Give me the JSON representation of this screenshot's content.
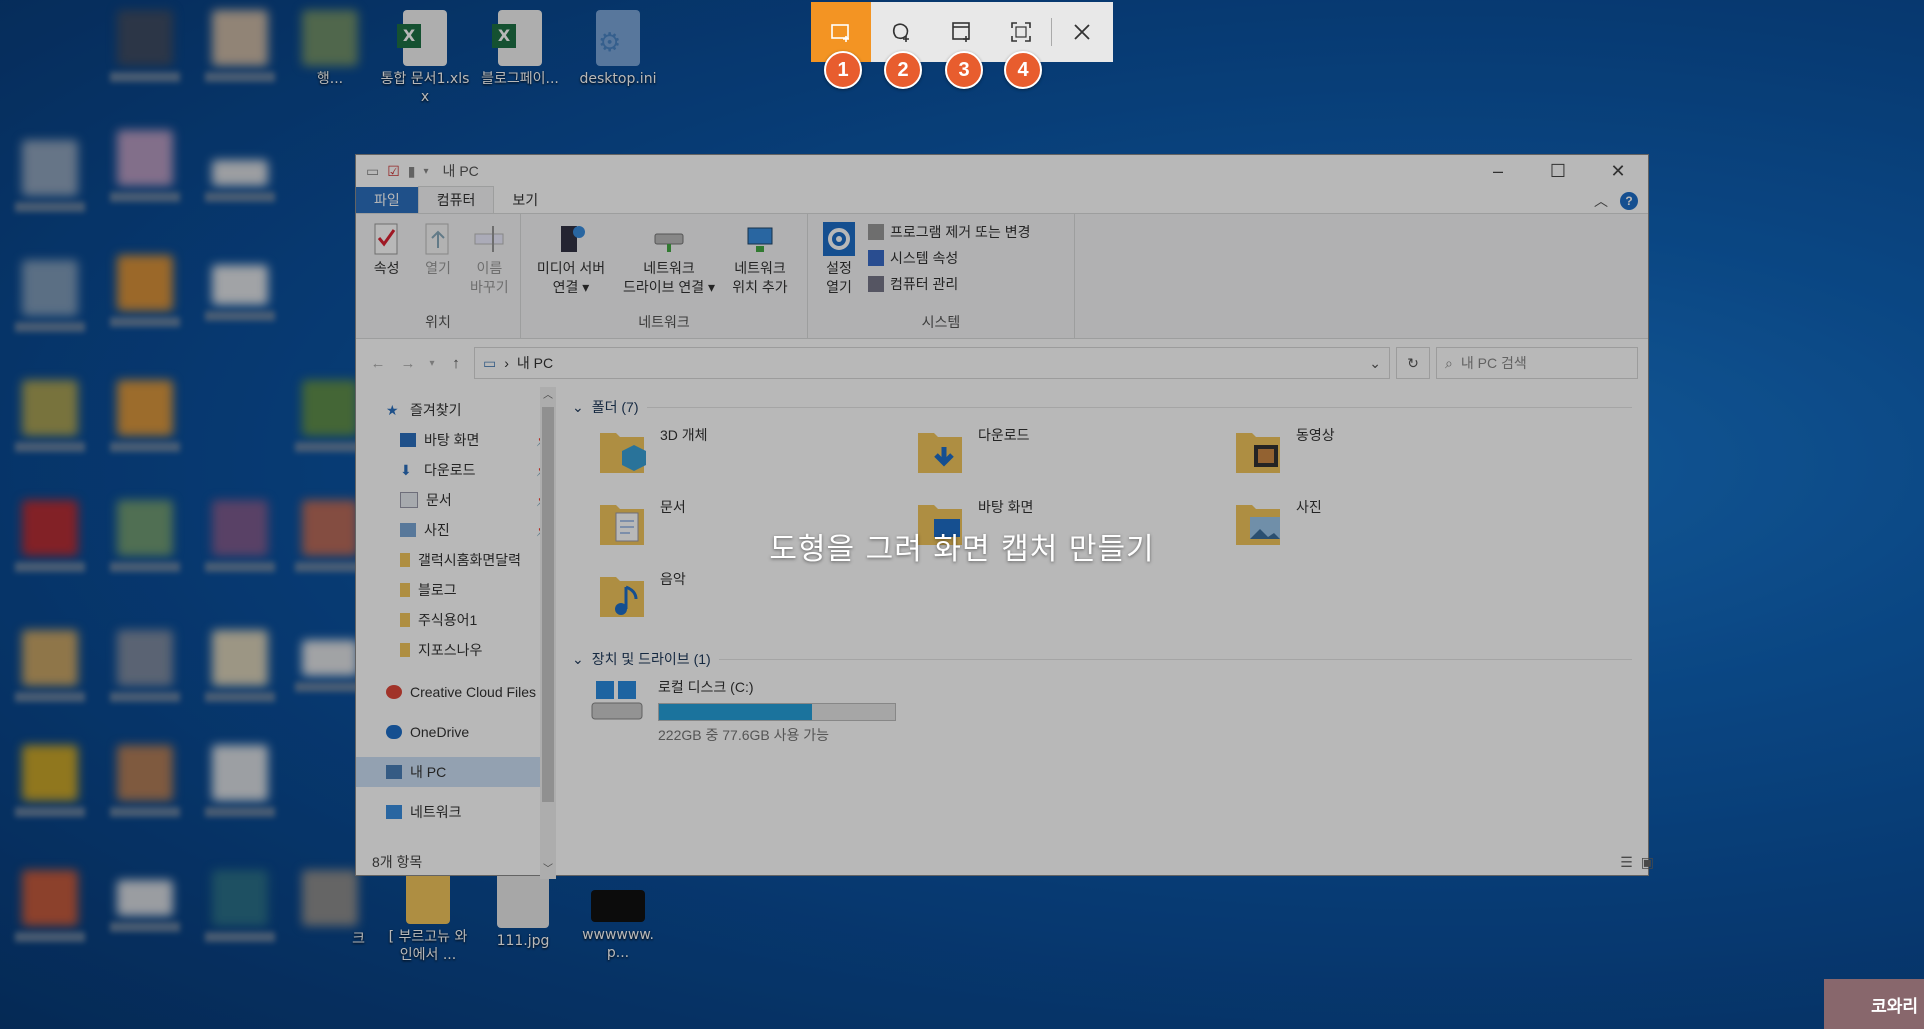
{
  "snip_toolbar": {
    "buttons": [
      {
        "icon": "rectangle-snip-icon"
      },
      {
        "icon": "freeform-snip-icon"
      },
      {
        "icon": "window-snip-icon"
      },
      {
        "icon": "fullscreen-snip-icon"
      },
      {
        "icon": "close-icon"
      }
    ],
    "badges": [
      "1",
      "2",
      "3",
      "4"
    ],
    "active_color": "#f39423",
    "badge_color": "#e85d2e"
  },
  "overlay_text": "도형을 그려 화면 캡처 만들기",
  "desktop_icons": [
    {
      "label": "행..."
    },
    {
      "label": "통합 문서1.xlsx"
    },
    {
      "label": "블로그페이..."
    },
    {
      "label": "desktop.ini"
    },
    {
      "label": "크"
    },
    {
      "label": "[ 부르고뉴 와인에서 ..."
    },
    {
      "label": "111.jpg"
    },
    {
      "label": "wwwwww.p..."
    }
  ],
  "explorer": {
    "title": "내 PC",
    "tabs": [
      "파일",
      "컴퓨터",
      "보기"
    ],
    "ribbon": {
      "location_group": {
        "title": "위치",
        "buttons": [
          "속성",
          "열기",
          "이름\n바꾸기"
        ]
      },
      "network_group": {
        "title": "네트워크",
        "buttons": [
          "미디어 서버\n연결 ▾",
          "네트워크\n드라이브 연결 ▾",
          "네트워크\n위치 추가"
        ]
      },
      "system_group": {
        "title": "시스템",
        "settings": "설정\n열기",
        "links": [
          "프로그램 제거 또는 변경",
          "시스템 속성",
          "컴퓨터 관리"
        ]
      }
    },
    "address": "내 PC",
    "search_placeholder": "내 PC 검색",
    "nav": [
      {
        "label": "즐겨찾기",
        "level": 1,
        "icon": "star-icon"
      },
      {
        "label": "바탕 화면",
        "level": 2,
        "icon": "desktop-icon",
        "pinned": true
      },
      {
        "label": "다운로드",
        "level": 2,
        "icon": "download-icon",
        "pinned": true
      },
      {
        "label": "문서",
        "level": 2,
        "icon": "document-icon",
        "pinned": true
      },
      {
        "label": "사진",
        "level": 2,
        "icon": "picture-icon",
        "pinned": true
      },
      {
        "label": "갤럭시홈화면달력",
        "level": 2,
        "icon": "folder-icon"
      },
      {
        "label": "블로그",
        "level": 2,
        "icon": "folder-icon"
      },
      {
        "label": "주식용어1",
        "level": 2,
        "icon": "folder-icon"
      },
      {
        "label": "지포스나우",
        "level": 2,
        "icon": "folder-icon"
      },
      {
        "label": "Creative Cloud Files",
        "level": 1,
        "icon": "creative-cloud-icon"
      },
      {
        "label": "OneDrive",
        "level": 1,
        "icon": "onedrive-icon"
      },
      {
        "label": "내 PC",
        "level": 1,
        "icon": "pc-icon",
        "selected": true
      },
      {
        "label": "네트워크",
        "level": 1,
        "icon": "network-icon"
      }
    ],
    "folders_header": "폴더 (7)",
    "folders": [
      "3D 개체",
      "다운로드",
      "동영상",
      "문서",
      "바탕 화면",
      "사진",
      "음악"
    ],
    "drives_header": "장치 및 드라이브 (1)",
    "drive": {
      "name": "로컬 디스크 (C:)",
      "free_text": "222GB 중 77.6GB 사용 가능",
      "used_fraction": 0.65
    },
    "status": "8개 항목"
  },
  "watermark": "코와리"
}
